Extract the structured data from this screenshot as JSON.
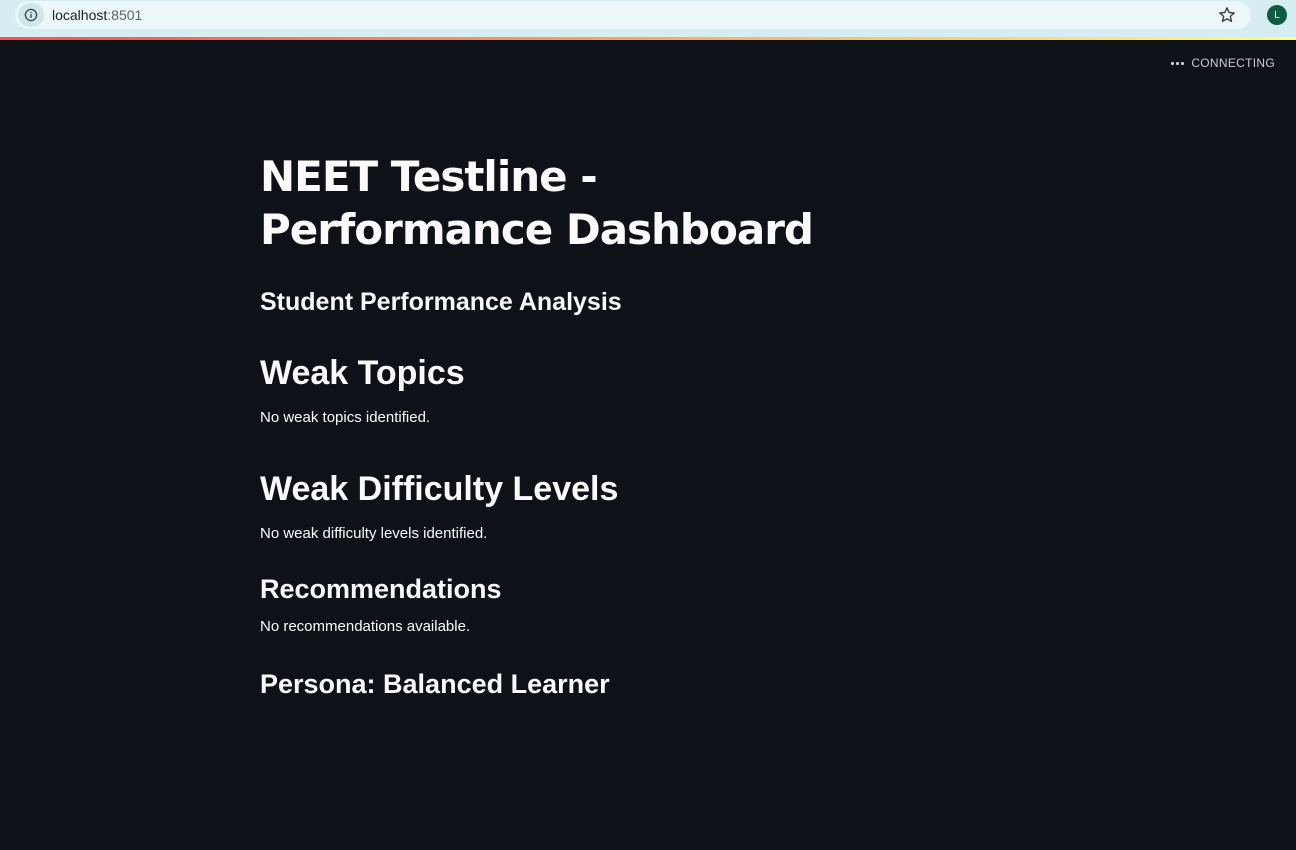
{
  "browser": {
    "url_host": "localhost",
    "url_port": ":8501",
    "profile_initial": "L",
    "icons": {
      "site_info": "info-icon",
      "bookmark": "star-icon"
    }
  },
  "status": {
    "text": "CONNECTING",
    "icon": "more-dots-icon"
  },
  "page": {
    "title": "NEET Testline - Performance Dashboard",
    "subtitle": "Student Performance Analysis",
    "sections": {
      "weak_topics": {
        "heading": "Weak Topics",
        "message": "No weak topics identified."
      },
      "weak_difficulty": {
        "heading": "Weak Difficulty Levels",
        "message": "No weak difficulty levels identified."
      },
      "recommendations": {
        "heading": "Recommendations",
        "message": "No recommendations available."
      },
      "persona": {
        "heading": "Persona: Balanced Learner"
      }
    }
  },
  "colors": {
    "background": "#0e1117",
    "text": "#fafafa",
    "decoration_start": "#ff4b4b",
    "decoration_end": "#fffd80",
    "browser_bar": "#d6eef2",
    "profile_avatar": "#0f5b45"
  }
}
